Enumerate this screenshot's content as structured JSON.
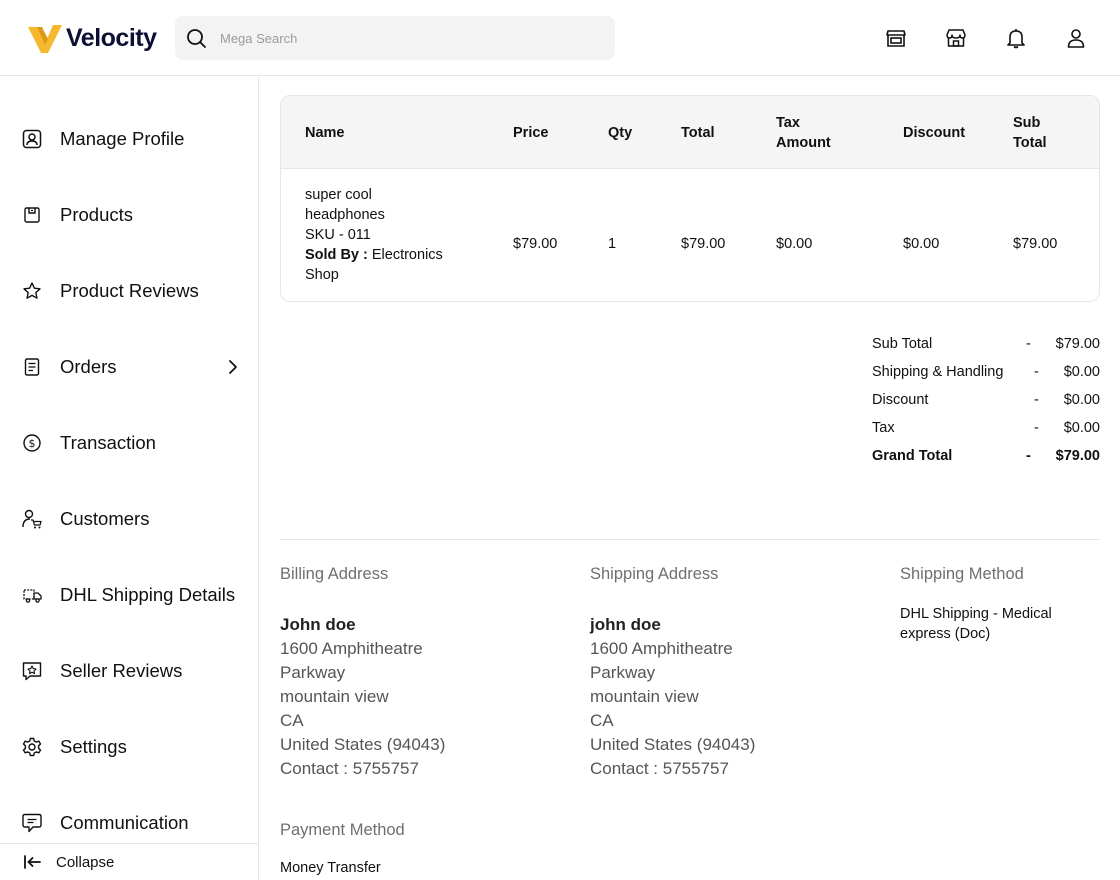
{
  "header": {
    "brand": "Velocity",
    "search_placeholder": "Mega Search",
    "icons": [
      "store-icon",
      "shop-icon",
      "bell-icon",
      "user-icon"
    ]
  },
  "sidebar": {
    "items": [
      {
        "label": "Manage Profile",
        "icon": "profile-icon"
      },
      {
        "label": "Products",
        "icon": "box-icon"
      },
      {
        "label": "Product Reviews",
        "icon": "star-icon"
      },
      {
        "label": "Orders",
        "icon": "orders-icon",
        "has_submenu": true
      },
      {
        "label": "Transaction",
        "icon": "dollar-icon"
      },
      {
        "label": "Customers",
        "icon": "customers-icon"
      },
      {
        "label": "DHL Shipping Details",
        "icon": "truck-icon"
      },
      {
        "label": "Seller Reviews",
        "icon": "review-icon"
      },
      {
        "label": "Settings",
        "icon": "gear-icon"
      },
      {
        "label": "Communication",
        "icon": "chat-icon"
      }
    ],
    "collapse_label": "Collapse"
  },
  "order_table": {
    "columns": {
      "name": "Name",
      "price": "Price",
      "qty": "Qty",
      "total": "Total",
      "tax_1": "Tax",
      "tax_2": "Amount",
      "discount": "Discount",
      "sub_1": "Sub",
      "sub_2": "Total"
    },
    "rows": [
      {
        "name_1": "super cool",
        "name_2": "headphones",
        "sku": "SKU - 011",
        "sold_by_label": "Sold By :",
        "seller_1": " Electronics",
        "seller_2": "Shop",
        "price": "$79.00",
        "qty": "1",
        "total": "$79.00",
        "tax_amount": "$0.00",
        "discount": "$0.00",
        "sub_total": "$79.00"
      }
    ]
  },
  "summary": [
    {
      "label": "Sub Total",
      "sep": "-",
      "value": "$79.00"
    },
    {
      "label": "Shipping & Handling",
      "sep": "-",
      "value": "$0.00"
    },
    {
      "label": "Discount",
      "sep": "-",
      "value": "$0.00"
    },
    {
      "label": "Tax",
      "sep": "-",
      "value": "$0.00"
    },
    {
      "label": "Grand Total",
      "sep": "-",
      "value": "$79.00"
    }
  ],
  "billing": {
    "title": "Billing Address",
    "name": "John doe",
    "line1": "1600 Amphitheatre",
    "line2": "Parkway",
    "city": "mountain view",
    "state": "CA",
    "country": "United States (94043)",
    "contact": "Contact : 5755757"
  },
  "shipping": {
    "title": "Shipping Address",
    "name": "john doe",
    "line1": "1600 Amphitheatre",
    "line2": "Parkway",
    "city": "mountain view",
    "state": "CA",
    "country": "United States (94043)",
    "contact": "Contact : 5755757"
  },
  "shipping_method": {
    "title": "Shipping Method",
    "value_1": "DHL Shipping - Medical",
    "value_2": "express (Doc)"
  },
  "payment_method": {
    "title": "Payment Method",
    "value": "Money Transfer"
  },
  "colors": {
    "brand_yellow": "#f5b82e",
    "brand_navy": "#0c1033",
    "border": "#e6e6e6",
    "table_header_bg": "#f5f5f5"
  }
}
